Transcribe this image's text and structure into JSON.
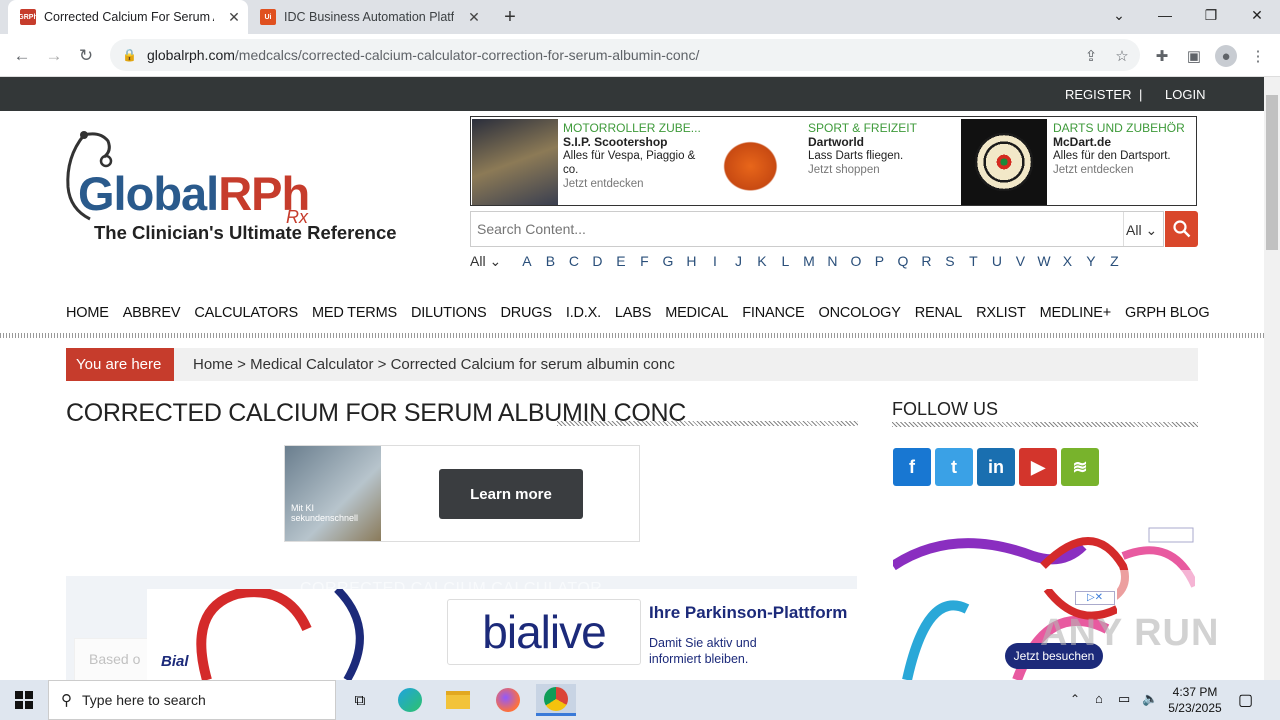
{
  "browser": {
    "tabs": [
      {
        "label": "Corrected Calcium For Serum Al",
        "favicon_text": "GRPh",
        "active": true
      },
      {
        "label": "IDC Business Automation Platfo",
        "favicon_text": "Ui",
        "active": false
      }
    ],
    "url_host": "globalrph.com",
    "url_path": "/medcalcs/corrected-calcium-calculator-correction-for-serum-albumin-conc/"
  },
  "site": {
    "top_links": {
      "register": "REGISTER",
      "separator": "|",
      "login": "LOGIN"
    },
    "logo": {
      "name_a": "Global",
      "name_b": "RPh",
      "rx": "Rx",
      "tagline": "The Clinician's Ultimate Reference"
    },
    "top_ad": [
      {
        "category": "MOTORROLLER ZUBE...",
        "brand": "S.I.P. Scootershop",
        "desc": "Alles für Vespa, Piaggio & co.",
        "cta": "Jetzt entdecken"
      },
      {
        "category": "SPORT & FREIZEIT",
        "brand": "Dartworld",
        "desc": "Lass Darts fliegen.",
        "cta": "Jetzt shoppen"
      },
      {
        "category": "DARTS UND ZUBEHÖR",
        "brand": "McDart.de",
        "desc": "Alles für den Dartsport.",
        "cta": "Jetzt entdecken"
      }
    ],
    "search": {
      "placeholder": "Search Content...",
      "scope": "All"
    },
    "alpha_all": "All",
    "alphabet": [
      "A",
      "B",
      "C",
      "D",
      "E",
      "F",
      "G",
      "H",
      "I",
      "J",
      "K",
      "L",
      "M",
      "N",
      "O",
      "P",
      "Q",
      "R",
      "S",
      "T",
      "U",
      "V",
      "W",
      "X",
      "Y",
      "Z"
    ],
    "nav": [
      "HOME",
      "ABBREV",
      "CALCULATORS",
      "MED TERMS",
      "DILUTIONS",
      "DRUGS",
      "I.D.X.",
      "LABS",
      "MEDICAL",
      "FINANCE",
      "ONCOLOGY",
      "RENAL",
      "RXLIST",
      "MEDLINE+",
      "GRPH BLOG"
    ],
    "breadcrumb": {
      "label": "You are here",
      "path": "Home > Medical Calculator > Corrected Calcium for serum albumin conc"
    },
    "page_title": "CORRECTED CALCIUM FOR SERUM ALBUMIN CONC",
    "follow_title": "FOLLOW US",
    "social": [
      {
        "icon": "facebook-icon",
        "glyph": "f",
        "color": "#1877d2"
      },
      {
        "icon": "twitter-icon",
        "glyph": "t",
        "color": "#3aa1e6"
      },
      {
        "icon": "linkedin-icon",
        "glyph": "in",
        "color": "#1a6fb0"
      },
      {
        "icon": "youtube-icon",
        "glyph": "▶",
        "color": "#d3352c"
      },
      {
        "icon": "spotify-icon",
        "glyph": "≋",
        "color": "#78b32c"
      }
    ],
    "mid_ad": {
      "image_text": "Mit KI sekundenschnell",
      "button": "Learn more"
    },
    "calculator": {
      "title": "CORRECTED CALCIUM CALCULATOR",
      "intro": "Based o"
    },
    "bottom_ad": {
      "brand": "bialive",
      "company": "Bial",
      "headline": "Ihre Parkinson-Plattform",
      "desc": "Damit Sie aktiv und informiert bleiben.",
      "cta": "Jetzt besuchen"
    }
  },
  "taskbar": {
    "search_placeholder": "Type here to search",
    "time": "4:37 PM",
    "date": "5/23/2025"
  },
  "watermark": "ANY RUN"
}
